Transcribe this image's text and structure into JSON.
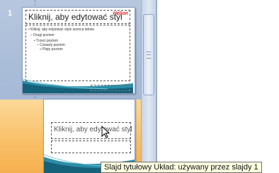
{
  "slide_panel": {
    "slides": [
      {
        "number": "1",
        "title": "Kliknij, aby edytować styl",
        "logo": "Helion",
        "bullets": [
          "• Kliknij, aby edytować style wzorca tekstu",
          "– Drugi poziom",
          "• Trzeci poziom",
          "– Czwarty poziom",
          "» Piąty poziom"
        ]
      },
      {
        "number": "",
        "title": "Kliknij, aby edytować styl"
      }
    ]
  },
  "tooltip": {
    "text": "Slajd tytułowy Układ: używany przez slajdy 1"
  },
  "colors": {
    "pane_blue": "#a9bcd8",
    "selection_orange": "#f9c06a",
    "tooltip_bg": "#ffffe1",
    "logo_red": "#e02020"
  }
}
